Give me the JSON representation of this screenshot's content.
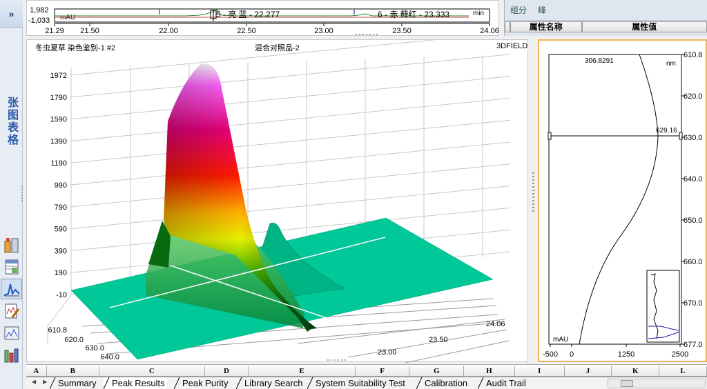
{
  "nav": {
    "collapse_label": "»",
    "vertical_title": "张图表格"
  },
  "overview": {
    "y_max": "1,982",
    "y_min": "-1,033",
    "y_unit": "mAU",
    "x_unit": "min",
    "x_ticks": [
      "21.29",
      "21.50",
      "22.00",
      "22.50",
      "23.00",
      "23.50",
      "24.06"
    ],
    "peak_label_1": "5 - 亮 蓝 - 22.277",
    "peak_label_2": "6 - 赤 藓红 - 23.333"
  },
  "properties": {
    "tabs": [
      "组分",
      "峰"
    ],
    "col_name": "属性名称",
    "col_value": "属性值"
  },
  "plot3d": {
    "left_title": "冬虫夏草 染色鉴别-1 #2",
    "center_title": "混合对照品-2",
    "right_title": "3DFIELD",
    "z_ticks": [
      "1972",
      "1790",
      "1590",
      "1390",
      "1190",
      "990",
      "790",
      "590",
      "390",
      "190",
      "-10"
    ],
    "wl_ticks": [
      "610.8",
      "620.0",
      "630.0",
      "640.0"
    ],
    "time_ticks": [
      "23.00",
      "23.50",
      "24.06"
    ],
    "surface_color": "#00c898"
  },
  "spectrum": {
    "top_label": "306.8291",
    "unit_label": "nm",
    "cursor_label": "629.16",
    "x_unit": "mAU",
    "y_ticks": [
      "610.8",
      "620.0",
      "630.0",
      "640.0",
      "650.0",
      "660.0",
      "670.0",
      "677.0"
    ],
    "x_ticks": [
      "-500",
      "0",
      "1250",
      "2500"
    ]
  },
  "sheet": {
    "columns": [
      "A",
      "B",
      "C",
      "D",
      "E",
      "F",
      "G",
      "H",
      "I",
      "J",
      "K",
      "L"
    ],
    "tabs": [
      "Summary",
      "Peak Results",
      "Peak Purity",
      "Library Search",
      "System Suitability Test",
      "Calibration",
      "Audit Trail"
    ],
    "active_tab": "Peak Results"
  }
}
